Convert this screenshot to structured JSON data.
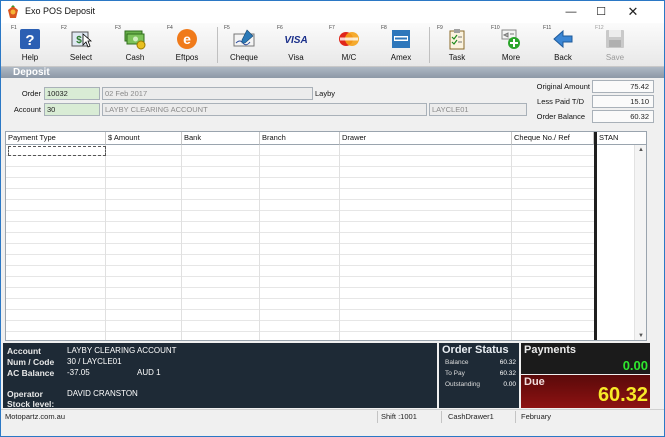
{
  "window": {
    "title": "Exo POS  Deposit"
  },
  "toolbar": {
    "buttons": [
      {
        "fkey": "F1",
        "label": "Help",
        "icon": "help-icon"
      },
      {
        "fkey": "F2",
        "label": "Select",
        "icon": "select-icon"
      },
      {
        "fkey": "F3",
        "label": "Cash",
        "icon": "cash-icon"
      },
      {
        "fkey": "F4",
        "label": "Eftpos",
        "icon": "eftpos-icon"
      },
      {
        "fkey": "F5",
        "label": "Cheque",
        "icon": "cheque-icon"
      },
      {
        "fkey": "F6",
        "label": "Visa",
        "icon": "visa-icon"
      },
      {
        "fkey": "F7",
        "label": "M/C",
        "icon": "mastercard-icon"
      },
      {
        "fkey": "F8",
        "label": "Amex",
        "icon": "amex-icon"
      },
      {
        "fkey": "F9",
        "label": "Task",
        "icon": "task-icon"
      },
      {
        "fkey": "F10",
        "label": "More",
        "icon": "more-icon"
      },
      {
        "fkey": "F11",
        "label": "Back",
        "icon": "back-icon"
      },
      {
        "fkey": "F12",
        "label": "Save",
        "icon": "save-icon"
      }
    ]
  },
  "section": {
    "label": "Deposit"
  },
  "form": {
    "order_label": "Order",
    "order_value": "10032",
    "order_date": "02 Feb 2017",
    "order_type": "Layby",
    "account_label": "Account",
    "account_value": "30",
    "account_name": "LAYBY CLEARING ACCOUNT",
    "account_code": "LAYCLE01"
  },
  "summary": {
    "original_amount_label": "Original Amount",
    "original_amount": "75.42",
    "less_paid_label": "Less Paid T/D",
    "less_paid": "15.10",
    "order_balance_label": "Order Balance",
    "order_balance": "60.32"
  },
  "grid": {
    "columns": [
      "Payment Type",
      "$ Amount",
      "Bank",
      "Branch",
      "Drawer",
      "Cheque No./ Ref",
      "STAN"
    ]
  },
  "info": {
    "account_label": "Account",
    "account_value": "LAYBY CLEARING ACCOUNT",
    "numcode_label": "Num / Code",
    "numcode_value": "30 / LAYCLE01",
    "acbalance_label": "AC Balance",
    "acbalance_value": "-37.05",
    "currency": "AUD 1",
    "operator_label": "Operator",
    "operator_value": "DAVID CRANSTON",
    "stock_label": "Stock level:"
  },
  "order_status": {
    "title": "Order Status",
    "balance_label": "Balance",
    "balance_value": "60.32",
    "topay_label": "To Pay",
    "topay_value": "60.32",
    "outstanding_label": "Outstanding",
    "outstanding_value": "0.00"
  },
  "payments": {
    "title": "Payments",
    "value": "0.00"
  },
  "due": {
    "title": "Due",
    "value": "60.32"
  },
  "statusbar": {
    "site": "Motopartz.com.au",
    "shift": "Shift :1001",
    "drawer": "CashDrawer1",
    "period": "February"
  },
  "colors": {
    "accent": "#2b78c5",
    "payments_value": "#2ee62e",
    "due_value": "#f7ea28",
    "due_bg": "#8e1212",
    "info_bg": "#1e2a36"
  }
}
